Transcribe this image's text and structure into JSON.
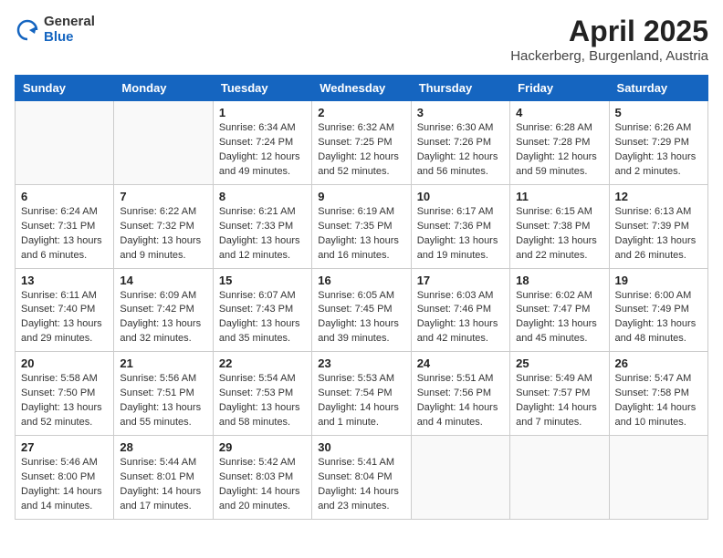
{
  "header": {
    "logo_general": "General",
    "logo_blue": "Blue",
    "month_title": "April 2025",
    "location": "Hackerberg, Burgenland, Austria"
  },
  "days_of_week": [
    "Sunday",
    "Monday",
    "Tuesday",
    "Wednesday",
    "Thursday",
    "Friday",
    "Saturday"
  ],
  "weeks": [
    [
      {
        "day": "",
        "detail": ""
      },
      {
        "day": "",
        "detail": ""
      },
      {
        "day": "1",
        "detail": "Sunrise: 6:34 AM\nSunset: 7:24 PM\nDaylight: 12 hours and 49 minutes."
      },
      {
        "day": "2",
        "detail": "Sunrise: 6:32 AM\nSunset: 7:25 PM\nDaylight: 12 hours and 52 minutes."
      },
      {
        "day": "3",
        "detail": "Sunrise: 6:30 AM\nSunset: 7:26 PM\nDaylight: 12 hours and 56 minutes."
      },
      {
        "day": "4",
        "detail": "Sunrise: 6:28 AM\nSunset: 7:28 PM\nDaylight: 12 hours and 59 minutes."
      },
      {
        "day": "5",
        "detail": "Sunrise: 6:26 AM\nSunset: 7:29 PM\nDaylight: 13 hours and 2 minutes."
      }
    ],
    [
      {
        "day": "6",
        "detail": "Sunrise: 6:24 AM\nSunset: 7:31 PM\nDaylight: 13 hours and 6 minutes."
      },
      {
        "day": "7",
        "detail": "Sunrise: 6:22 AM\nSunset: 7:32 PM\nDaylight: 13 hours and 9 minutes."
      },
      {
        "day": "8",
        "detail": "Sunrise: 6:21 AM\nSunset: 7:33 PM\nDaylight: 13 hours and 12 minutes."
      },
      {
        "day": "9",
        "detail": "Sunrise: 6:19 AM\nSunset: 7:35 PM\nDaylight: 13 hours and 16 minutes."
      },
      {
        "day": "10",
        "detail": "Sunrise: 6:17 AM\nSunset: 7:36 PM\nDaylight: 13 hours and 19 minutes."
      },
      {
        "day": "11",
        "detail": "Sunrise: 6:15 AM\nSunset: 7:38 PM\nDaylight: 13 hours and 22 minutes."
      },
      {
        "day": "12",
        "detail": "Sunrise: 6:13 AM\nSunset: 7:39 PM\nDaylight: 13 hours and 26 minutes."
      }
    ],
    [
      {
        "day": "13",
        "detail": "Sunrise: 6:11 AM\nSunset: 7:40 PM\nDaylight: 13 hours and 29 minutes."
      },
      {
        "day": "14",
        "detail": "Sunrise: 6:09 AM\nSunset: 7:42 PM\nDaylight: 13 hours and 32 minutes."
      },
      {
        "day": "15",
        "detail": "Sunrise: 6:07 AM\nSunset: 7:43 PM\nDaylight: 13 hours and 35 minutes."
      },
      {
        "day": "16",
        "detail": "Sunrise: 6:05 AM\nSunset: 7:45 PM\nDaylight: 13 hours and 39 minutes."
      },
      {
        "day": "17",
        "detail": "Sunrise: 6:03 AM\nSunset: 7:46 PM\nDaylight: 13 hours and 42 minutes."
      },
      {
        "day": "18",
        "detail": "Sunrise: 6:02 AM\nSunset: 7:47 PM\nDaylight: 13 hours and 45 minutes."
      },
      {
        "day": "19",
        "detail": "Sunrise: 6:00 AM\nSunset: 7:49 PM\nDaylight: 13 hours and 48 minutes."
      }
    ],
    [
      {
        "day": "20",
        "detail": "Sunrise: 5:58 AM\nSunset: 7:50 PM\nDaylight: 13 hours and 52 minutes."
      },
      {
        "day": "21",
        "detail": "Sunrise: 5:56 AM\nSunset: 7:51 PM\nDaylight: 13 hours and 55 minutes."
      },
      {
        "day": "22",
        "detail": "Sunrise: 5:54 AM\nSunset: 7:53 PM\nDaylight: 13 hours and 58 minutes."
      },
      {
        "day": "23",
        "detail": "Sunrise: 5:53 AM\nSunset: 7:54 PM\nDaylight: 14 hours and 1 minute."
      },
      {
        "day": "24",
        "detail": "Sunrise: 5:51 AM\nSunset: 7:56 PM\nDaylight: 14 hours and 4 minutes."
      },
      {
        "day": "25",
        "detail": "Sunrise: 5:49 AM\nSunset: 7:57 PM\nDaylight: 14 hours and 7 minutes."
      },
      {
        "day": "26",
        "detail": "Sunrise: 5:47 AM\nSunset: 7:58 PM\nDaylight: 14 hours and 10 minutes."
      }
    ],
    [
      {
        "day": "27",
        "detail": "Sunrise: 5:46 AM\nSunset: 8:00 PM\nDaylight: 14 hours and 14 minutes."
      },
      {
        "day": "28",
        "detail": "Sunrise: 5:44 AM\nSunset: 8:01 PM\nDaylight: 14 hours and 17 minutes."
      },
      {
        "day": "29",
        "detail": "Sunrise: 5:42 AM\nSunset: 8:03 PM\nDaylight: 14 hours and 20 minutes."
      },
      {
        "day": "30",
        "detail": "Sunrise: 5:41 AM\nSunset: 8:04 PM\nDaylight: 14 hours and 23 minutes."
      },
      {
        "day": "",
        "detail": ""
      },
      {
        "day": "",
        "detail": ""
      },
      {
        "day": "",
        "detail": ""
      }
    ]
  ]
}
